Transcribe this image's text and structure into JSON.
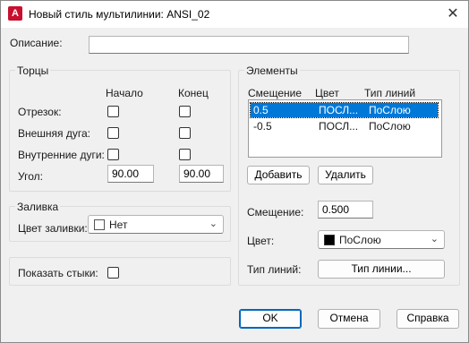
{
  "window": {
    "title": "Новый стиль мультилинии: ANSI_02",
    "app_icon": "A"
  },
  "description": {
    "label": "Описание:",
    "value": ""
  },
  "caps": {
    "title": "Торцы",
    "col_start": "Начало",
    "col_end": "Конец",
    "line_label": "Отрезок:",
    "outer_arc_label": "Внешняя дуга:",
    "inner_arcs_label": "Внутренние дуги:",
    "angle_label": "Угол:",
    "angle_start": "90.00",
    "angle_end": "90.00",
    "line_start": false,
    "line_end": false,
    "outer_start": false,
    "outer_end": false,
    "inner_start": false,
    "inner_end": false
  },
  "fill": {
    "title": "Заливка",
    "color_label": "Цвет заливки:",
    "color_value": "Нет",
    "swatch_color": "#ffffff"
  },
  "joints": {
    "label": "Показать стыки:",
    "checked": false
  },
  "elements": {
    "title": "Элементы",
    "headers": [
      "Смещение",
      "Цвет",
      "Тип линий"
    ],
    "rows": [
      {
        "offset": "0.5",
        "color": "ПОСЛ...",
        "linetype": "ПоСлою",
        "selected": true
      },
      {
        "offset": "-0.5",
        "color": "ПОСЛ...",
        "linetype": "ПоСлою",
        "selected": false
      }
    ],
    "add_button": "Добавить",
    "delete_button": "Удалить",
    "offset_label": "Смещение:",
    "offset_value": "0.500",
    "color_label": "Цвет:",
    "color_value": "ПоСлою",
    "color_swatch": "#000000",
    "linetype_label": "Тип линий:",
    "linetype_button": "Тип линии..."
  },
  "footer": {
    "ok": "OK",
    "cancel": "Отмена",
    "help": "Справка"
  },
  "colors": {
    "selection": "#0078d7",
    "default_border": "#0067c0",
    "brand": "#c8102e"
  }
}
